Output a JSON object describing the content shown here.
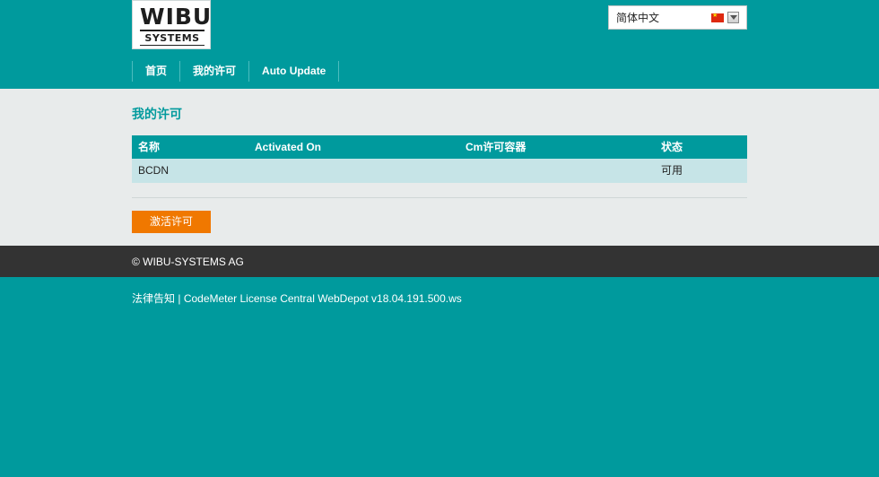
{
  "logo": {
    "top": "WIBU",
    "bottom": "SYSTEMS"
  },
  "language": {
    "selected": "简体中文"
  },
  "nav": {
    "items": [
      "首页",
      "我的许可",
      "Auto Update"
    ]
  },
  "main": {
    "title": "我的许可",
    "table": {
      "headers": [
        "名称",
        "Activated On",
        "Cm许可容器",
        "状态"
      ],
      "rows": [
        [
          "BCDN",
          "",
          "",
          "可用"
        ]
      ]
    },
    "activate_label": "激活许可"
  },
  "footer": {
    "copyright": "© WIBU-SYSTEMS AG",
    "legal": "法律告知",
    "separator": " | ",
    "version": "CodeMeter License Central WebDepot v18.04.191.500.ws"
  },
  "colors": {
    "primary": "#009a9d",
    "accent": "#f07800",
    "footer": "#333333",
    "content_bg": "#e8ebeb",
    "row_bg": "#c6e4e7"
  },
  "icons": [
    "wibu-logo",
    "china-flag-icon",
    "dropdown-arrow-icon"
  ]
}
